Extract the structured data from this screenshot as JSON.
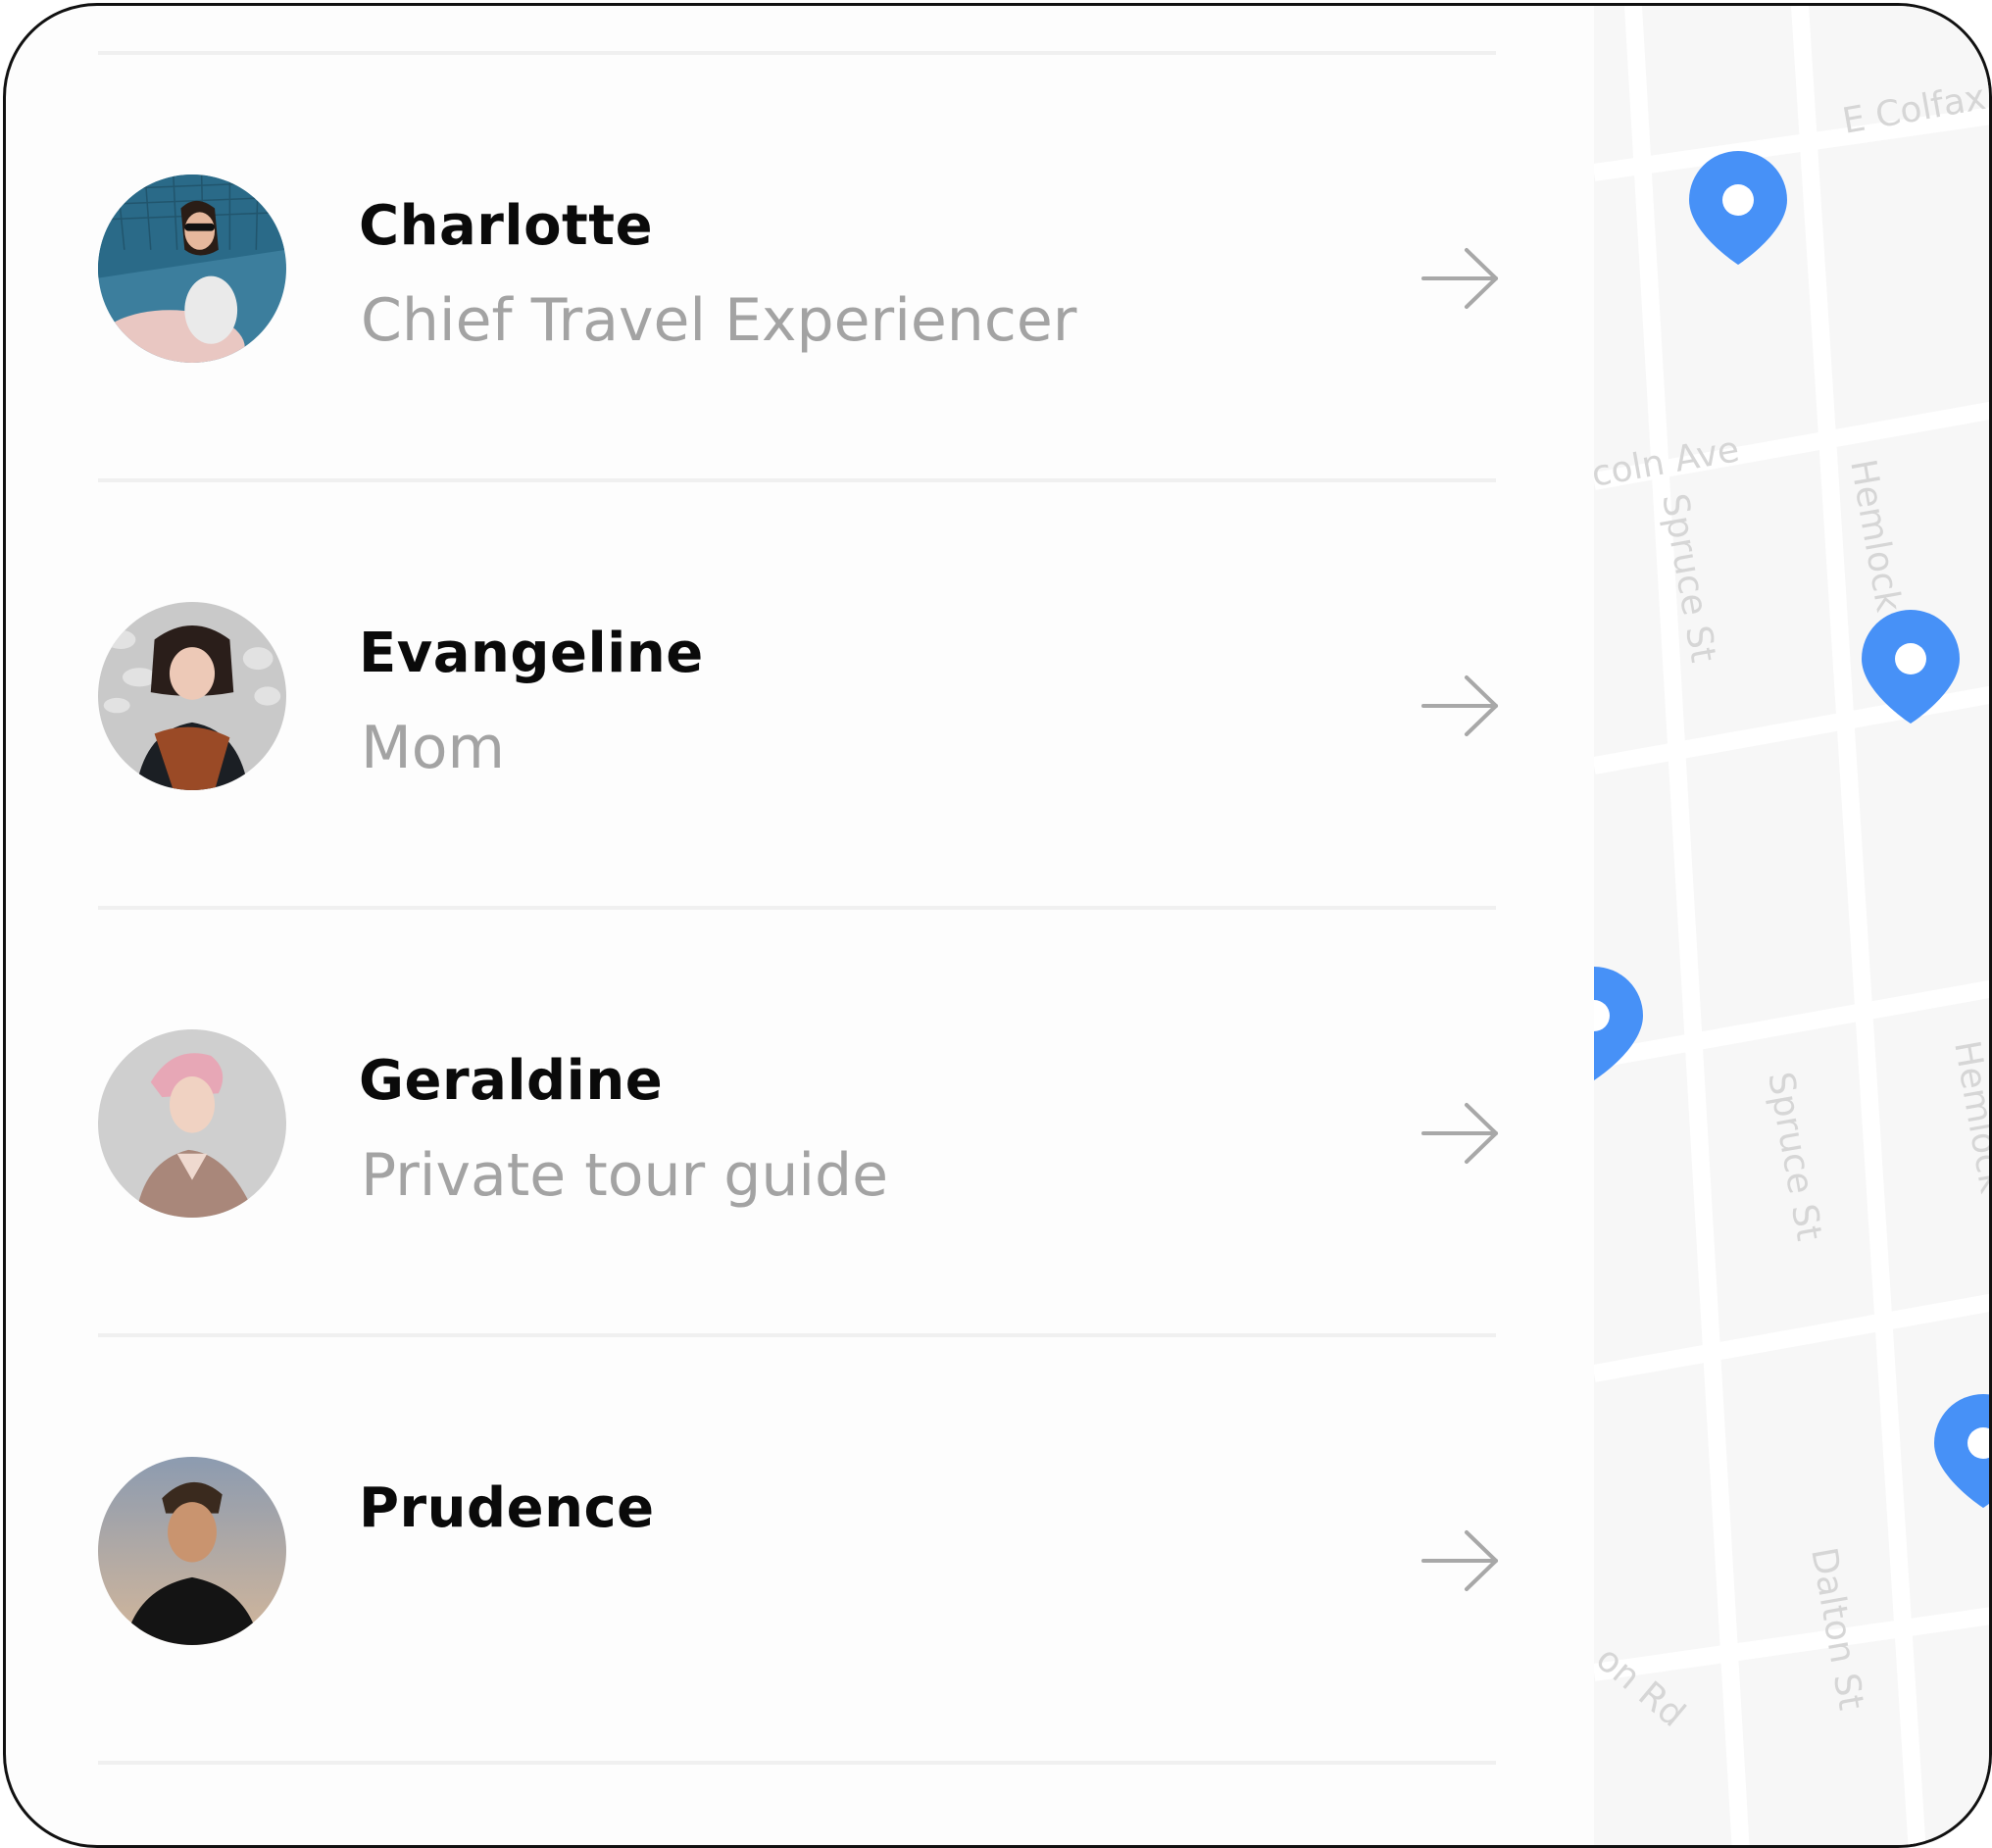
{
  "contacts": [
    {
      "name": "Charlotte",
      "subtitle": "Chief Travel Experiencer",
      "avatar": "avatar-charlotte"
    },
    {
      "name": "Evangeline",
      "subtitle": "Mom",
      "avatar": "avatar-evangeline"
    },
    {
      "name": "Geraldine",
      "subtitle": "Private tour guide",
      "avatar": "avatar-geraldine"
    },
    {
      "name": "Prudence",
      "subtitle": "",
      "avatar": "avatar-prudence"
    }
  ],
  "map": {
    "streets": [
      "E Colfax",
      "coln Ave",
      "Spruce St",
      "Hemlock",
      "Spruce St",
      "Hemlock",
      "Dalton St",
      "on Rd"
    ],
    "pin_color": "#0a6cf5"
  },
  "colors": {
    "name": "#0a0a0a",
    "subtitle": "#a3a3a3",
    "divider": "#f0f0f0",
    "arrow": "#a8a8a8"
  }
}
